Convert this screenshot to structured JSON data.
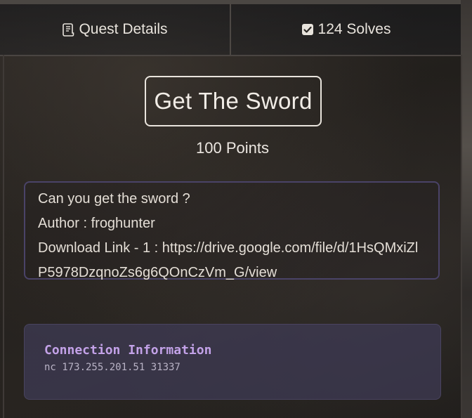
{
  "tabs": {
    "details": {
      "label": "Quest Details",
      "icon": "scroll-icon"
    },
    "solves": {
      "label": "124 Solves",
      "icon": "checkbox-icon"
    }
  },
  "challenge": {
    "title": "Get The Sword",
    "points": "100 Points",
    "description": "Can you get the sword ?",
    "author": "Author : froghunter",
    "download_prefix": "Download Link - 1 : ",
    "download_url": "https://drive.google.com/file/d/1HsQMxiZlP5978DzqnoZs6g6QOnCzVm_G/view"
  },
  "connection": {
    "title": "Connection Information",
    "command": "nc 173.255.201.51 31337"
  },
  "colors": {
    "accent_purple": "#c3a2e8",
    "connection_bg": "#3e3a52",
    "description_border": "#4a4368"
  }
}
